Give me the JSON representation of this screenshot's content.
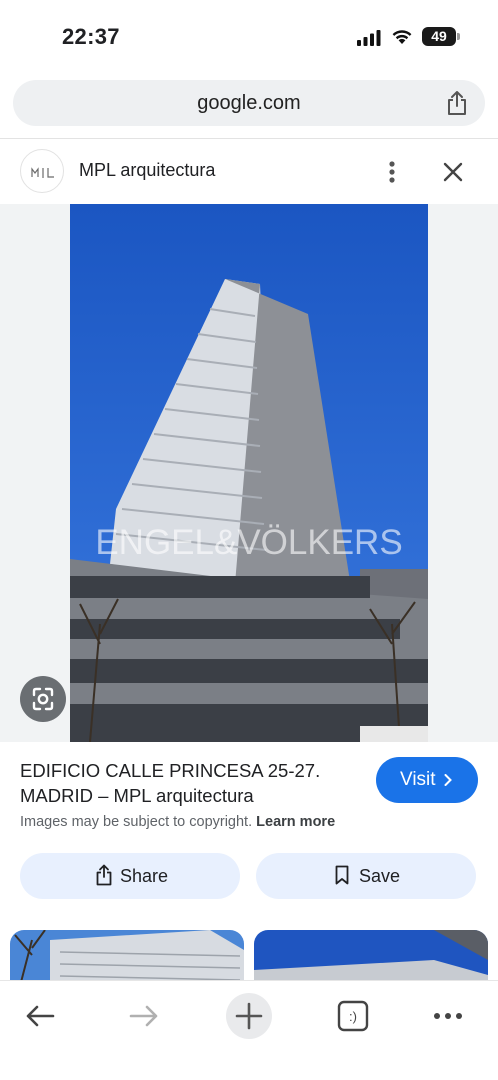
{
  "status_bar": {
    "time": "22:37",
    "battery": "49"
  },
  "url_bar": {
    "url": "google.com"
  },
  "source": {
    "name": "MPL arquitectura",
    "logo_text": "MIL"
  },
  "image": {
    "watermark": "ENGEL&VÖLKERS"
  },
  "result": {
    "title": "EDIFICIO CALLE PRINCESA 25-27. MADRID – MPL arquitectura",
    "visit_label": "Visit",
    "copyright_text": "Images may be subject to copyright.",
    "learn_more": "Learn more"
  },
  "actions": {
    "share_label": "Share",
    "save_label": "Save"
  },
  "icons": {
    "lens": "google-lens-icon",
    "share_top": "share-icon",
    "more": "more-vertical-icon",
    "close": "close-icon",
    "back": "back-arrow-icon",
    "forward": "forward-arrow-icon",
    "new_tab": "plus-icon",
    "tabs": "tab-switcher-icon",
    "menu": "more-horizontal-icon"
  },
  "colors": {
    "accent": "#1a73e8",
    "chip_bg": "#e8f0fe",
    "sky": "#1f5cc4"
  }
}
